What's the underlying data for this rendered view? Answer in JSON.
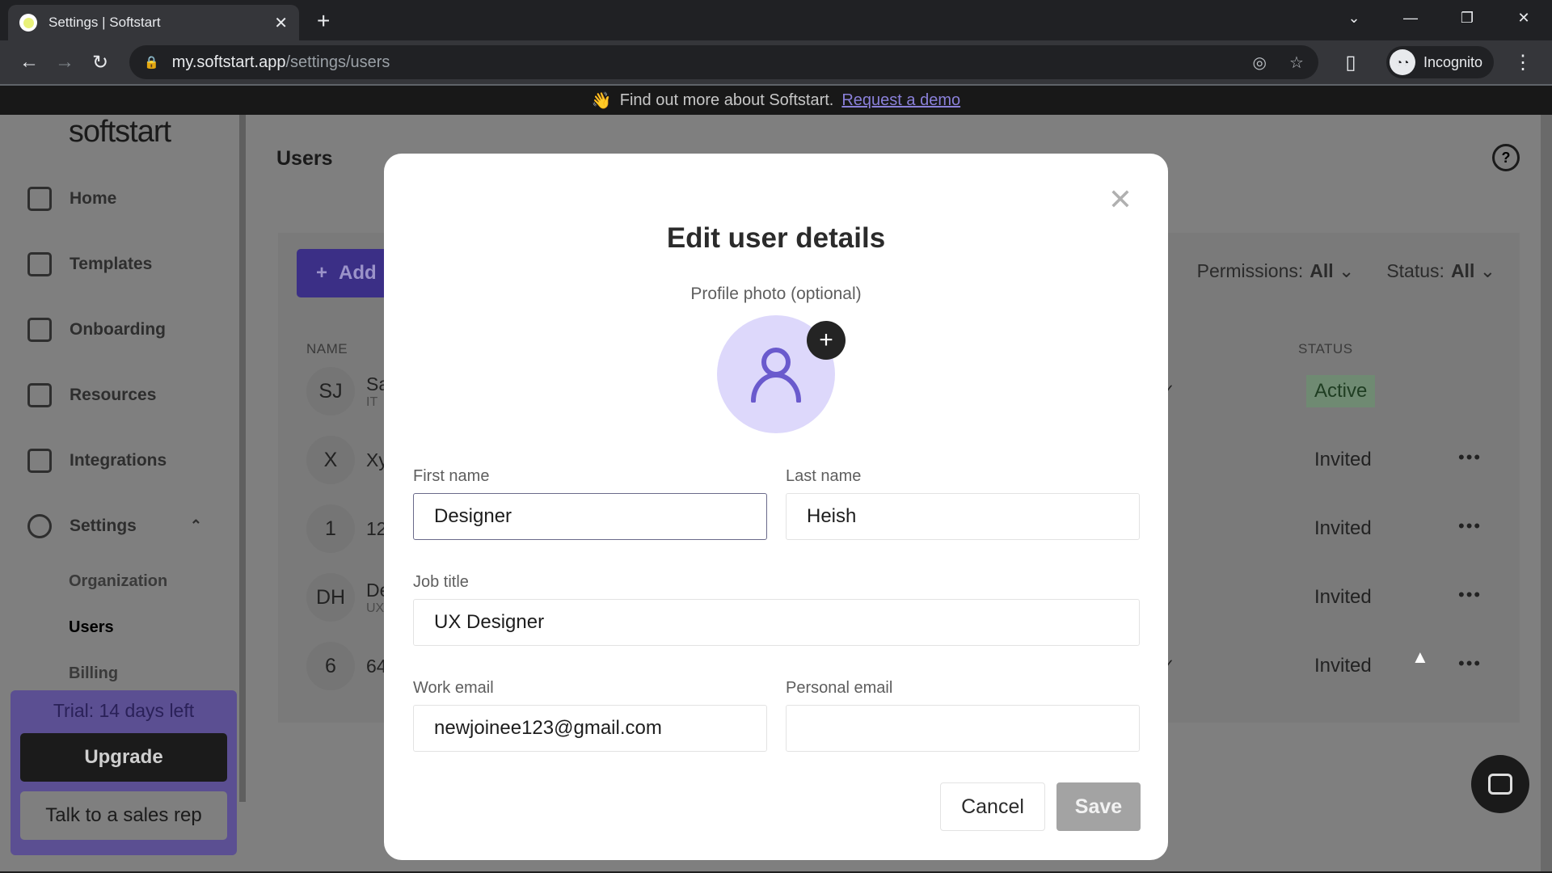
{
  "browser": {
    "tab_title": "Settings | Softstart",
    "url_host": "my.softstart.app",
    "url_path": "/settings/users",
    "profile_label": "Incognito"
  },
  "banner": {
    "emoji": "👋",
    "text": "Find out more about Softstart.",
    "link": "Request a demo"
  },
  "sidebar": {
    "logo": "softstart",
    "items": [
      {
        "label": "Home",
        "icon": "home-icon"
      },
      {
        "label": "Templates",
        "icon": "templates-icon"
      },
      {
        "label": "Onboarding",
        "icon": "calendar-icon"
      },
      {
        "label": "Resources",
        "icon": "book-icon"
      },
      {
        "label": "Integrations",
        "icon": "puzzle-icon"
      },
      {
        "label": "Settings",
        "icon": "gear-icon"
      }
    ],
    "settings_sub": [
      "Organization",
      "Users",
      "Billing"
    ],
    "active_sub": "Users",
    "trial_text": "Trial: 14 days left",
    "upgrade_label": "Upgrade",
    "sales_label": "Talk to a sales rep"
  },
  "page": {
    "title": "Users",
    "add_label": "Add",
    "filters": {
      "permissions_label": "Permissions:",
      "permissions_value": "All",
      "status_label": "Status:",
      "status_value": "All"
    },
    "columns": {
      "name": "NAME",
      "status": "STATUS"
    },
    "rows": [
      {
        "initials": "SJ",
        "name": "Sa",
        "sub": "IT",
        "status": "Active",
        "checked": true,
        "more": false
      },
      {
        "initials": "X",
        "name": "Xy",
        "sub": "",
        "status": "Invited",
        "checked": false,
        "more": true
      },
      {
        "initials": "1",
        "name": "12",
        "sub": "",
        "status": "Invited",
        "checked": false,
        "more": true
      },
      {
        "initials": "DH",
        "name": "De",
        "sub": "UX",
        "status": "Invited",
        "checked": false,
        "more": true
      },
      {
        "initials": "6",
        "name": "64",
        "sub": "",
        "status": "Invited",
        "checked": true,
        "more": true
      }
    ]
  },
  "modal": {
    "title": "Edit user details",
    "photo_label": "Profile photo (optional)",
    "fields": {
      "first_name": {
        "label": "First name",
        "value": "Designer"
      },
      "last_name": {
        "label": "Last name",
        "value": "Heish"
      },
      "job_title": {
        "label": "Job title",
        "value": "UX Designer"
      },
      "work_email": {
        "label": "Work email",
        "value": "newjoinee123@gmail.com"
      },
      "personal_email": {
        "label": "Personal email",
        "value": ""
      }
    },
    "cancel_label": "Cancel",
    "save_label": "Save"
  },
  "colors": {
    "accent": "#3b2f86",
    "avatar_bg": "#ddd8fb",
    "avatar_icon": "#6a5acd",
    "active_status": "#6f8a72"
  }
}
